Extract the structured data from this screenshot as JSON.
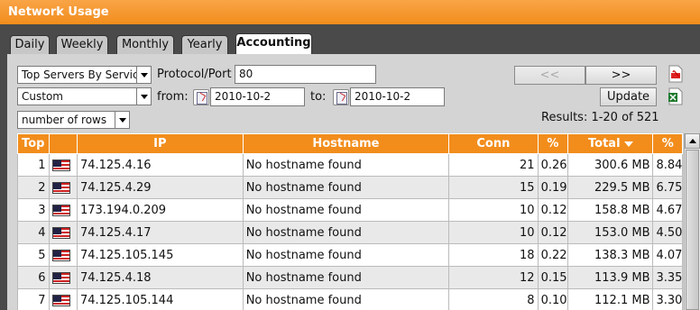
{
  "window": {
    "title": "Network Usage"
  },
  "tabs": [
    {
      "label": "Daily"
    },
    {
      "label": "Weekly"
    },
    {
      "label": "Monthly"
    },
    {
      "label": "Yearly"
    },
    {
      "label": "Accounting"
    }
  ],
  "filters": {
    "report_select": "Top Servers By Service",
    "protocol_label": "Protocol/Port",
    "protocol_value": "80",
    "range_select": "Custom",
    "from_label": "from:",
    "from_value": "2010-10-2",
    "to_label": "to:",
    "to_value": "2010-10-2",
    "rows_select": "number of rows"
  },
  "pager": {
    "prev": "<<",
    "next": ">>",
    "update": "Update",
    "results": "Results: 1-20 of 521"
  },
  "icons": {
    "pdf": "pdf-export-icon",
    "excel": "excel-export-icon",
    "calendar": "calendar-icon",
    "flag": "us-flag-icon"
  },
  "colors": {
    "accent": "#f28d1c",
    "dark": "#4a4a4a"
  },
  "table": {
    "headers": [
      "Top",
      "",
      "IP",
      "Hostname",
      "Conn",
      "%",
      "Total",
      "%"
    ],
    "rows": [
      {
        "top": "1",
        "ip": "74.125.4.16",
        "hostname": "No hostname found",
        "conn": "21",
        "conn_pct": "0.26",
        "total": "300.6 MB",
        "total_pct": "8.84"
      },
      {
        "top": "2",
        "ip": "74.125.4.29",
        "hostname": "No hostname found",
        "conn": "15",
        "conn_pct": "0.19",
        "total": "229.5 MB",
        "total_pct": "6.75"
      },
      {
        "top": "3",
        "ip": "173.194.0.209",
        "hostname": "No hostname found",
        "conn": "10",
        "conn_pct": "0.12",
        "total": "158.8 MB",
        "total_pct": "4.67"
      },
      {
        "top": "4",
        "ip": "74.125.4.17",
        "hostname": "No hostname found",
        "conn": "10",
        "conn_pct": "0.12",
        "total": "153.0 MB",
        "total_pct": "4.50"
      },
      {
        "top": "5",
        "ip": "74.125.105.145",
        "hostname": "No hostname found",
        "conn": "18",
        "conn_pct": "0.22",
        "total": "138.3 MB",
        "total_pct": "4.07"
      },
      {
        "top": "6",
        "ip": "74.125.4.18",
        "hostname": "No hostname found",
        "conn": "12",
        "conn_pct": "0.15",
        "total": "113.9 MB",
        "total_pct": "3.35"
      },
      {
        "top": "7",
        "ip": "74.125.105.144",
        "hostname": "No hostname found",
        "conn": "8",
        "conn_pct": "0.10",
        "total": "112.1 MB",
        "total_pct": "3.30"
      }
    ]
  }
}
